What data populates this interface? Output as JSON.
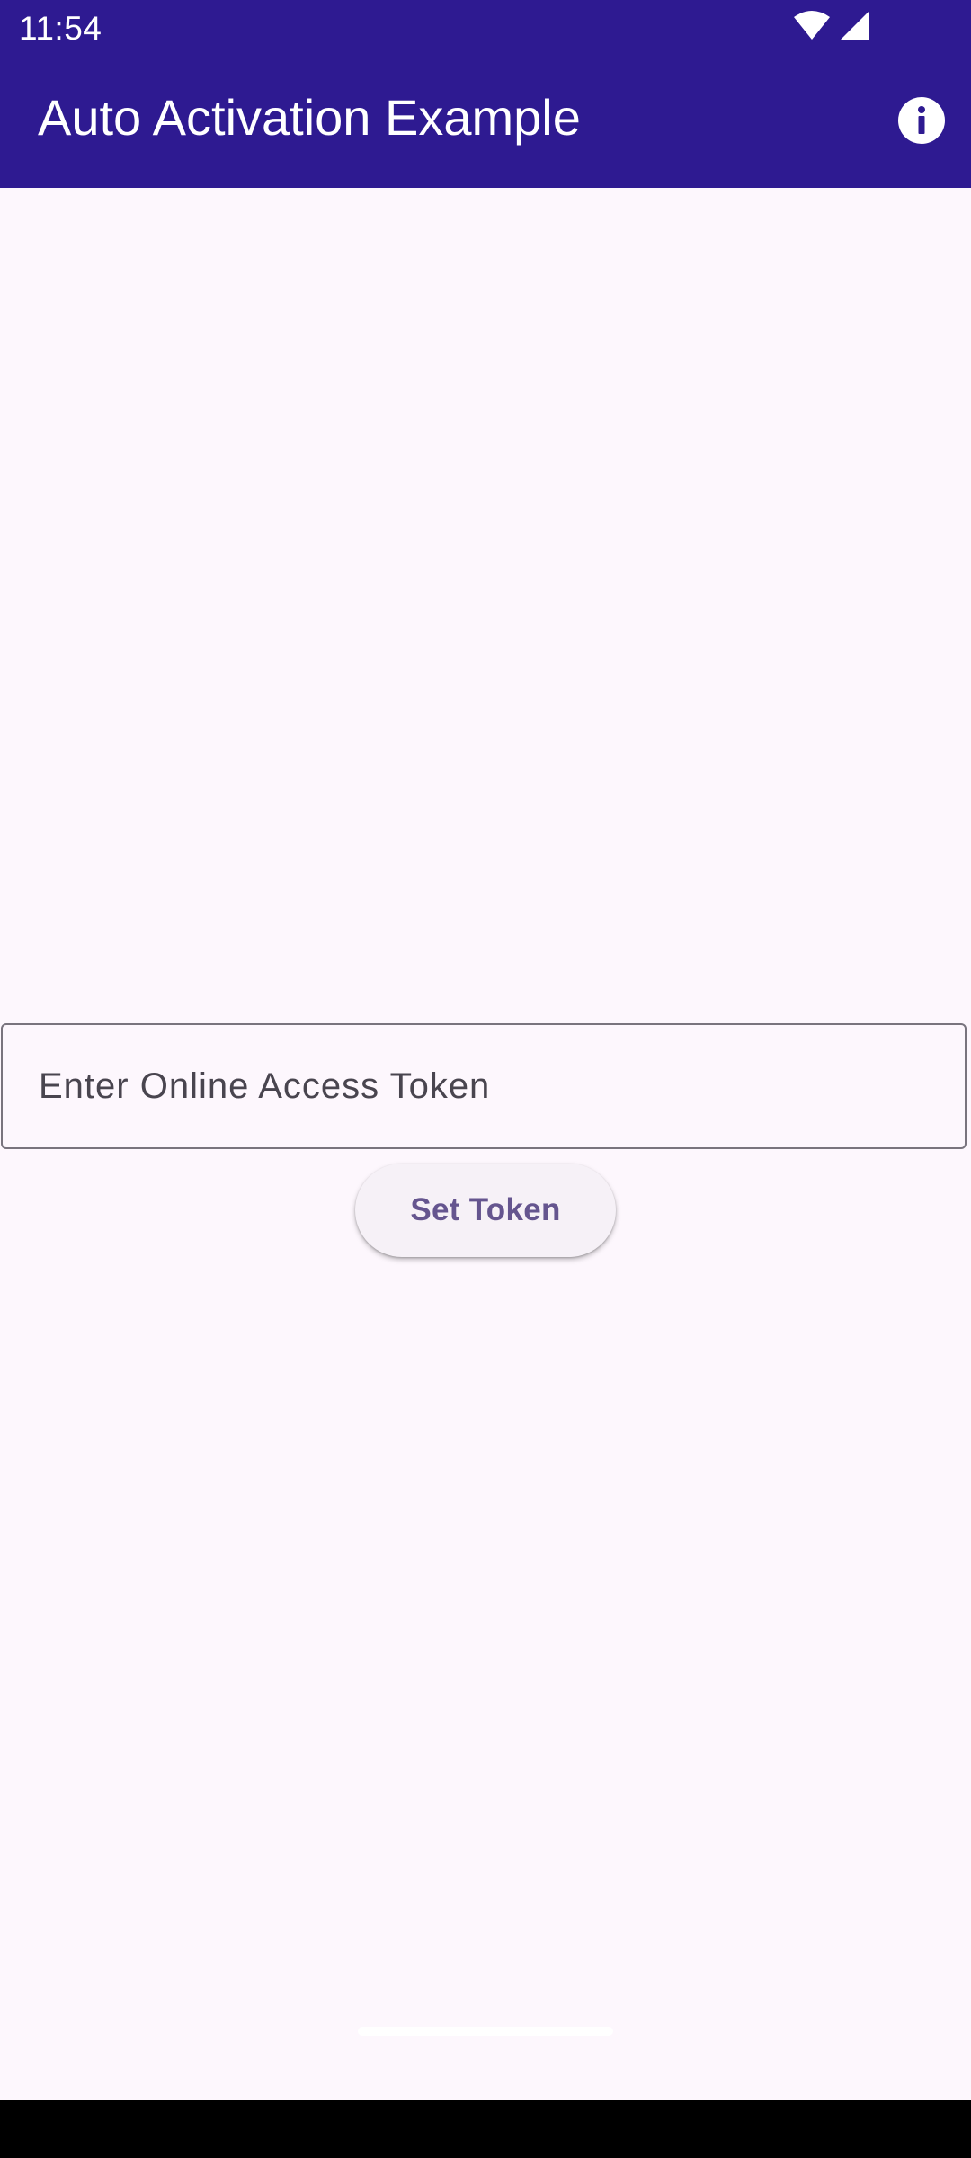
{
  "status_bar": {
    "time": "11:54",
    "icons": [
      "wifi-icon",
      "cellular-signal-icon"
    ]
  },
  "app_bar": {
    "title": "Auto Activation Example",
    "action_icon": "info-icon",
    "background_color": "#2E1A91"
  },
  "token_form": {
    "input_placeholder": "Enter Online Access Token",
    "input_value": "",
    "submit_label": "Set Token"
  },
  "colors": {
    "accent": "#65558F",
    "surface": "#FDF7FD"
  }
}
